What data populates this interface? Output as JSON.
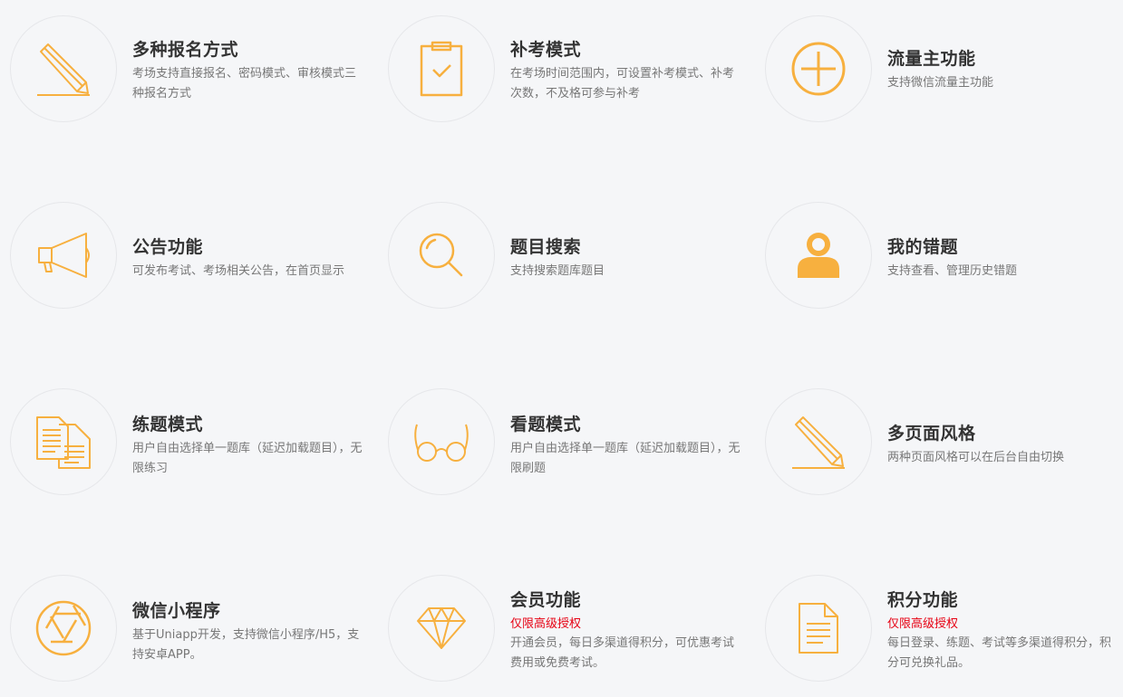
{
  "colors": {
    "accent": "#f7b03f",
    "badge": "#e60012",
    "title": "#333333",
    "desc": "#777777",
    "background": "#f5f6f8"
  },
  "features": [
    {
      "icon": "pencil-icon",
      "title": "多种报名方式",
      "badge": "",
      "desc": "考场支持直接报名、密码模式、审核模式三种报名方式"
    },
    {
      "icon": "clipboard-check-icon",
      "title": "补考模式",
      "badge": "",
      "desc": "在考场时间范围内，可设置补考模式、补考次数，不及格可参与补考"
    },
    {
      "icon": "plus-circle-icon",
      "title": "流量主功能",
      "badge": "",
      "desc": "支持微信流量主功能"
    },
    {
      "icon": "megaphone-icon",
      "title": "公告功能",
      "badge": "",
      "desc": "可发布考试、考场相关公告，在首页显示"
    },
    {
      "icon": "search-icon",
      "title": "题目搜索",
      "badge": "",
      "desc": "支持搜索题库题目"
    },
    {
      "icon": "user-icon",
      "title": "我的错题",
      "badge": "",
      "desc": "支持查看、管理历史错题"
    },
    {
      "icon": "documents-icon",
      "title": "练题模式",
      "badge": "",
      "desc": "用户自由选择单一题库（延迟加载题目），无限练习"
    },
    {
      "icon": "glasses-icon",
      "title": "看题模式",
      "badge": "",
      "desc": "用户自由选择单一题库（延迟加载题目），无限刷题"
    },
    {
      "icon": "pencil-icon",
      "title": "多页面风格",
      "badge": "",
      "desc": "两种页面风格可以在后台自由切换"
    },
    {
      "icon": "aperture-icon",
      "title": "微信小程序",
      "badge": "",
      "desc": "基于Uniapp开发，支持微信小程序/H5，支持安卓APP。"
    },
    {
      "icon": "diamond-icon",
      "title": "会员功能",
      "badge": "仅限高级授权",
      "desc": "开通会员，每日多渠道得积分，可优惠考试费用或免费考试。"
    },
    {
      "icon": "document-icon",
      "title": "积分功能",
      "badge": "仅限高级授权",
      "desc": "每日登录、练题、考试等多渠道得积分，积分可兑换礼品。"
    }
  ]
}
